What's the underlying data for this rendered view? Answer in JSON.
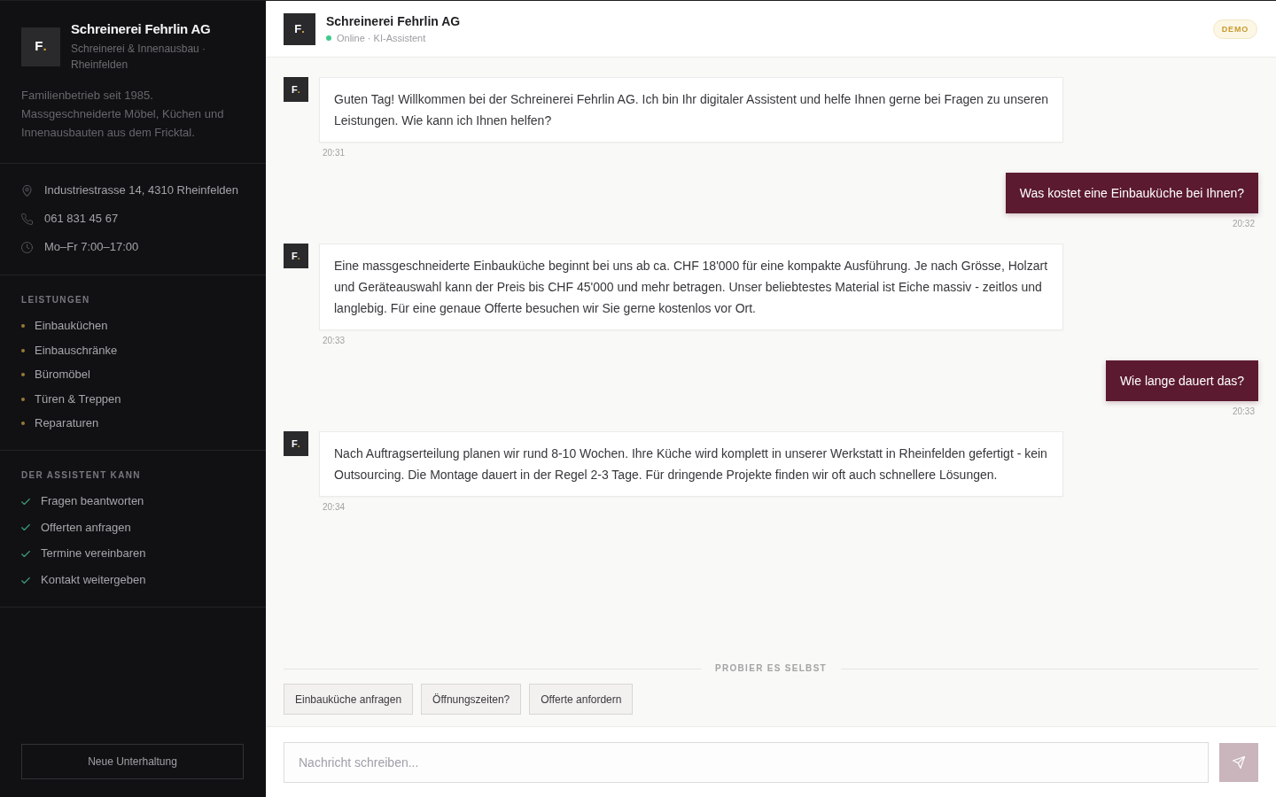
{
  "sidebar": {
    "logo": {
      "letter": "F",
      "accent": "."
    },
    "title": "Schreinerei Fehrlin AG",
    "subtitle": "Schreinerei & Innenausbau · Rheinfelden",
    "description": "Familienbetrieb seit 1985. Massgeschneiderte Möbel, Küchen und Innenausbauten aus dem Fricktal.",
    "contact": [
      {
        "kind": "address",
        "text": "Industriestrasse 14, 4310 Rheinfelden"
      },
      {
        "kind": "phone",
        "text": "061 831 45 67"
      },
      {
        "kind": "hours",
        "text": "Mo–Fr 7:00–17:00"
      }
    ],
    "services": {
      "heading": "LEISTUNGEN",
      "items": [
        "Einbauküchen",
        "Einbauschränke",
        "Büromöbel",
        "Türen & Treppen",
        "Reparaturen"
      ]
    },
    "capabilities": {
      "heading": "DER ASSISTENT KANN",
      "items": [
        "Fragen beantworten",
        "Offerten anfragen",
        "Termine vereinbaren",
        "Kontakt weitergeben"
      ]
    },
    "new_chat_button": "Neue Unterhaltung"
  },
  "header": {
    "avatar": {
      "letter": "F",
      "accent": "."
    },
    "title": "Schreinerei Fehrlin AG",
    "status": {
      "online": true,
      "text": "Online · KI-Assistent"
    },
    "badge": "DEMO"
  },
  "messages": [
    {
      "kind": "bot",
      "avatar": {
        "letter": "F",
        "accent": "."
      },
      "text": "Guten Tag! Willkommen bei der Schreinerei Fehrlin AG. Ich bin Ihr digitaler Assistent und helfe Ihnen gerne bei Fragen zu unseren Leistungen. Wie kann ich Ihnen helfen?",
      "time": "20:31"
    },
    {
      "kind": "user",
      "text": "Was kostet eine Einbauküche bei Ihnen?",
      "time": "20:32"
    },
    {
      "kind": "bot",
      "avatar": {
        "letter": "F",
        "accent": "."
      },
      "text": "Eine massgeschneiderte Einbauküche beginnt bei uns ab ca. CHF 18'000 für eine kompakte Ausführung. Je nach Grösse, Holzart und Geräteauswahl kann der Preis bis CHF 45'000 und mehr betragen. Unser beliebtestes Material ist Eiche massiv - zeitlos und langlebig. Für eine genaue Offerte besuchen wir Sie gerne kostenlos vor Ort.",
      "time": "20:33"
    },
    {
      "kind": "user",
      "text": "Wie lange dauert das?",
      "time": "20:33"
    },
    {
      "kind": "bot",
      "avatar": {
        "letter": "F",
        "accent": "."
      },
      "text": "Nach Auftragserteilung planen wir rund 8-10 Wochen. Ihre Küche wird komplett in unserer Werkstatt in Rheinfelden gefertigt - kein Outsourcing. Die Montage dauert in der Regel 2-3 Tage. Für dringende Projekte finden wir oft auch schnellere Lösungen.",
      "time": "20:34"
    }
  ],
  "suggestions": {
    "label": "PROBIER ES SELBST",
    "chips": [
      "Einbauküche anfragen",
      "Öffnungszeiten?",
      "Offerte anfordern"
    ]
  },
  "composer": {
    "placeholder": "Nachricht schreiben...",
    "send_button": {
      "disabled": true
    }
  }
}
